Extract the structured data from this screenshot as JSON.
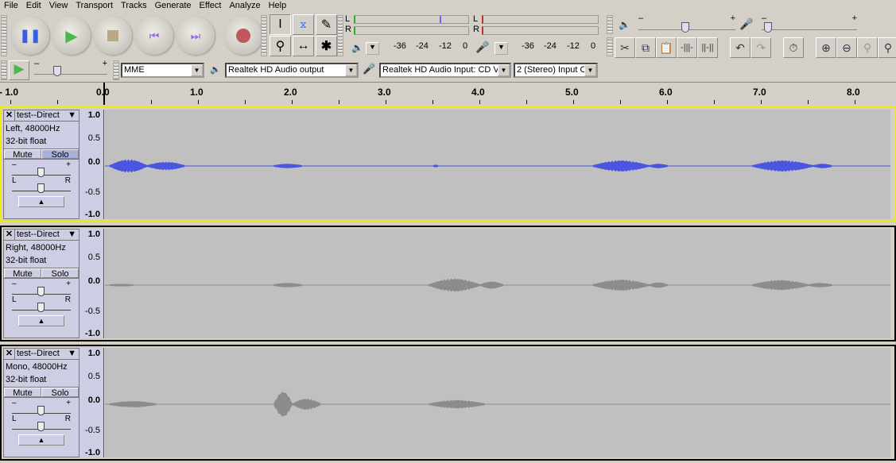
{
  "menu": [
    "File",
    "Edit",
    "View",
    "Transport",
    "Tracks",
    "Generate",
    "Effect",
    "Analyze",
    "Help"
  ],
  "meters": {
    "play_l": "L",
    "play_r": "R",
    "rec_l": "L",
    "rec_r": "R",
    "ticks": [
      "-36",
      "-24",
      "-12",
      "0"
    ]
  },
  "device": {
    "host": "MME",
    "output": "Realtek HD Audio output",
    "input": "Realtek HD Audio Input: CD Vo",
    "channels": "2 (Stereo) Input C"
  },
  "slider_labels": {
    "minus": "–",
    "plus": "+"
  },
  "ruler": {
    "labels": [
      "- 1.0",
      "0.0",
      "1.0",
      "2.0",
      "3.0",
      "4.0",
      "5.0",
      "6.0",
      "7.0",
      "8.0"
    ],
    "values": [
      -1,
      0,
      1,
      2,
      3,
      4,
      5,
      6,
      7,
      8
    ]
  },
  "colors": {
    "selected_wave": "#4a55e0",
    "wave": "#8c8c8c"
  },
  "tracks": [
    {
      "name": "test--Direct",
      "info1": "Left, 48000Hz",
      "info2": "32-bit float",
      "mute": "Mute",
      "solo": "Solo",
      "solo_on": true,
      "pan_l": "L",
      "pan_r": "R",
      "scale": [
        "1.0",
        "0.5",
        "0.0",
        "-0.5",
        "-1.0"
      ],
      "selected": true,
      "segments": [
        [
          0.05,
          0.45,
          0.12
        ],
        [
          0.45,
          0.85,
          0.07
        ],
        [
          1.8,
          2.1,
          0.03
        ],
        [
          3.5,
          3.55,
          0.01
        ],
        [
          5.2,
          5.8,
          0.1
        ],
        [
          5.8,
          6.0,
          0.03
        ],
        [
          6.9,
          7.55,
          0.1
        ],
        [
          7.55,
          7.75,
          0.03
        ]
      ]
    },
    {
      "name": "test--Direct",
      "info1": "Right, 48000Hz",
      "info2": "32-bit float",
      "mute": "Mute",
      "solo": "Solo",
      "solo_on": false,
      "pan_l": "L",
      "pan_r": "R",
      "scale": [
        "1.0",
        "0.5",
        "0.0",
        "-0.5",
        "-1.0"
      ],
      "selected": false,
      "segments": [
        [
          0.05,
          0.3,
          0.01
        ],
        [
          1.8,
          2.1,
          0.03
        ],
        [
          3.45,
          4.0,
          0.12
        ],
        [
          4.0,
          4.25,
          0.06
        ],
        [
          5.2,
          5.8,
          0.1
        ],
        [
          5.8,
          6.0,
          0.04
        ],
        [
          6.9,
          7.5,
          0.09
        ],
        [
          7.5,
          7.75,
          0.03
        ]
      ]
    },
    {
      "name": "test--Direct",
      "info1": "Mono, 48000Hz",
      "info2": "32-bit float",
      "mute": "Mute",
      "solo": "Solo",
      "solo_on": false,
      "pan_l": "L",
      "pan_r": "R",
      "scale": [
        "1.0",
        "0.5",
        "0.0",
        "-0.5",
        "-1.0"
      ],
      "selected": false,
      "segments": [
        [
          0.05,
          0.55,
          0.05
        ],
        [
          1.8,
          2.0,
          0.25
        ],
        [
          2.0,
          2.3,
          0.1
        ],
        [
          3.45,
          4.05,
          0.07
        ]
      ]
    }
  ]
}
